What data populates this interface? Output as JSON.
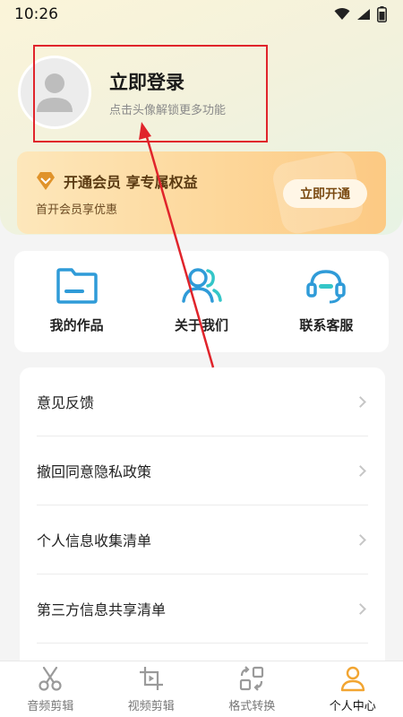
{
  "status": {
    "time": "10:26"
  },
  "profile": {
    "title": "立即登录",
    "subtitle": "点击头像解锁更多功能"
  },
  "vip": {
    "title": "开通会员 享专属权益",
    "subtitle": "首开会员享优惠",
    "button": "立即开通",
    "crown_icon": "diamond-crown-icon"
  },
  "quick": [
    {
      "label": "我的作品",
      "icon": "folder-icon"
    },
    {
      "label": "关于我们",
      "icon": "people-icon"
    },
    {
      "label": "联系客服",
      "icon": "headset-icon"
    }
  ],
  "menu": [
    {
      "label": "意见反馈"
    },
    {
      "label": "撤回同意隐私政策"
    },
    {
      "label": "个人信息收集清单"
    },
    {
      "label": "第三方信息共享清单"
    }
  ],
  "tabs": [
    {
      "label": "音频剪辑",
      "icon": "scissors-icon"
    },
    {
      "label": "视频剪辑",
      "icon": "video-crop-icon"
    },
    {
      "label": "格式转换",
      "icon": "convert-icon"
    },
    {
      "label": "个人中心",
      "icon": "person-icon",
      "active": true
    }
  ],
  "colors": {
    "accent_blue": "#2f9bd8",
    "active_orange": "#f2a531",
    "annotation_red": "#e0242b",
    "vip_text": "#5a3a12"
  }
}
